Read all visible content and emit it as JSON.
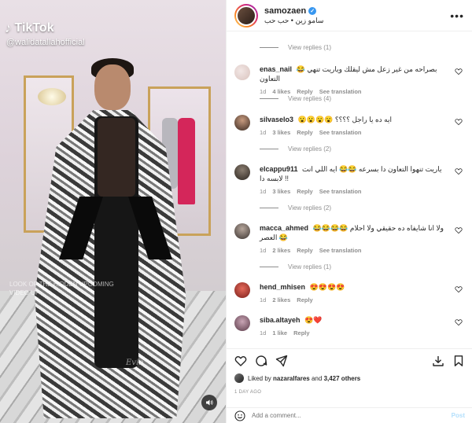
{
  "media": {
    "tiktok_brand": "TikTok",
    "tiktok_handle": "@walidatallahofficial",
    "overlay_text": "LOOK OF THE HIDDEN UPCOMING VIDEO UP",
    "signature": "Evin"
  },
  "header": {
    "username": "samozaen",
    "subtitle": "سامو زين • حب حب",
    "more_label": "•••"
  },
  "comments": [
    {
      "view_replies": "View replies (1)"
    },
    {
      "username": "enas_nail",
      "text": "😂 بصراحه من غير زعل مش ليقلك وياريت تنهي التعاون",
      "time": "1d",
      "likes": "4 likes",
      "reply": "Reply",
      "translate": "See translation"
    },
    {
      "view_replies": "View replies (4)"
    },
    {
      "username": "silvaselo3",
      "text": "😮😮😮😮 ايه ده يا راجل ؟؟؟؟",
      "time": "1d",
      "likes": "3 likes",
      "reply": "Reply",
      "translate": "See translation"
    },
    {
      "view_replies": "View replies (2)"
    },
    {
      "username": "elcappu911",
      "text": "ياريت تنهوا التعاون دا بسرعه 😂😂 ايه اللي انت لابسه دا !!",
      "time": "1d",
      "likes": "3 likes",
      "reply": "Reply",
      "translate": "See translation"
    },
    {
      "view_replies": "View replies (2)"
    },
    {
      "username": "macca_ahmed",
      "text": "😂😂😂😂 ولا انا شايفاه ده حقيقي ولا احلام العصر 😂",
      "time": "1d",
      "likes": "2 likes",
      "reply": "Reply",
      "translate": "See translation"
    },
    {
      "view_replies": "View replies (1)"
    },
    {
      "username": "hend_mhisen",
      "text": "😍😍😍😍",
      "time": "1d",
      "likes": "2 likes",
      "reply": "Reply"
    },
    {
      "username": "siba.altayeh",
      "text": "😍❤️",
      "time": "1d",
      "likes": "1 like",
      "reply": "Reply"
    }
  ],
  "likes": {
    "liked_by_prefix": "Liked by",
    "liked_by_user": "nazaralfares",
    "and_text": "and",
    "others_count": "3,427 others"
  },
  "timestamp": "1 DAY AGO",
  "add_comment": {
    "placeholder": "Add a comment...",
    "post_label": "Post"
  },
  "colors": {
    "accent_blue": "#3897f0",
    "post_disabled": "#b2dffc",
    "muted_text": "#8e8e8e"
  }
}
